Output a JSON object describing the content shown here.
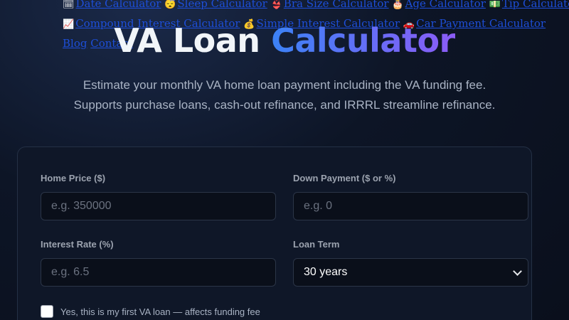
{
  "nav": {
    "line1": [
      {
        "icon": "🗓",
        "label": "Date Calculator"
      },
      {
        "icon": "😴",
        "label": "Sleep Calculator"
      },
      {
        "icon": "👙",
        "label": "Bra Size Calculator"
      },
      {
        "icon": "🎂",
        "label": "Age Calculator"
      },
      {
        "icon": "💵",
        "label": "Tip Calculator"
      }
    ],
    "line2": [
      {
        "icon": "📈",
        "label": "Compound Interest Calculator"
      },
      {
        "icon": "💰",
        "label": "Simple Interest Calculator"
      },
      {
        "icon": "🚗",
        "label": "Car Payment Calculator"
      }
    ],
    "line3": [
      {
        "label": "Blog"
      },
      {
        "label": "Contact"
      }
    ]
  },
  "header": {
    "title_part1": "VA Loan",
    "title_part2": "Calculator",
    "subtitle_line1": "Estimate your monthly VA home loan payment including the VA funding fee.",
    "subtitle_line2": "Supports purchase loans, cash-out refinance, and IRRRL streamline refinance."
  },
  "form": {
    "home_price": {
      "label": "Home Price ($)",
      "placeholder": "e.g. 350000"
    },
    "down_payment": {
      "label": "Down Payment ($ or %)",
      "placeholder": "e.g. 0"
    },
    "interest_rate": {
      "label": "Interest Rate (%)",
      "placeholder": "e.g. 6.5"
    },
    "loan_term": {
      "label": "Loan Term",
      "selected": "30 years"
    },
    "first_loan": {
      "label": "Yes, this is my first VA loan — affects funding fee",
      "checked": false
    }
  }
}
